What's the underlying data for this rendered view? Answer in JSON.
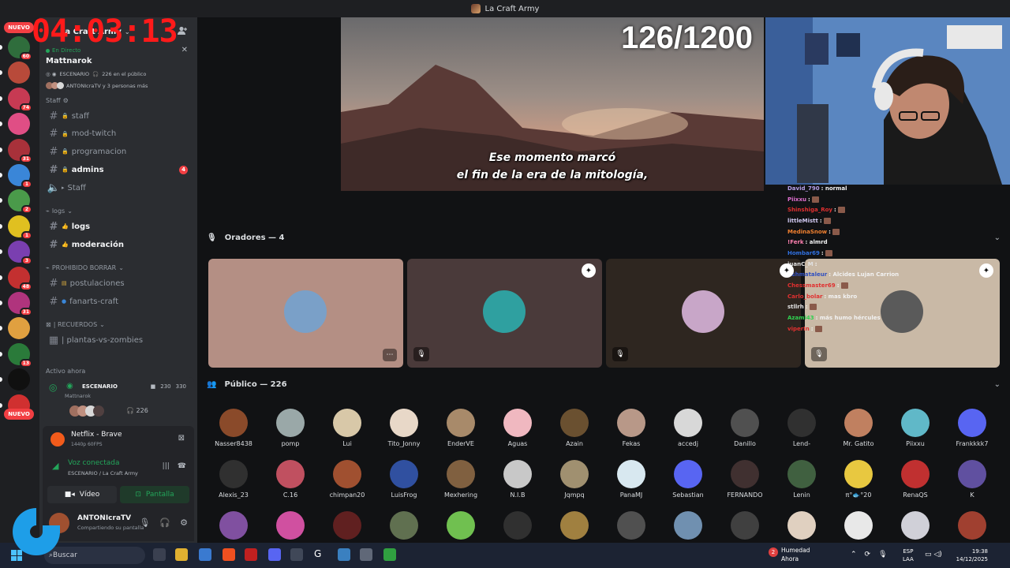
{
  "window": {
    "title": "La Craft Army"
  },
  "overlay": {
    "timer": "04:03:13",
    "progress": "126/1200"
  },
  "rail": {
    "new_label": "NUEVO",
    "servers": [
      {
        "color": "#2f6d3c",
        "badge": "60"
      },
      {
        "color": "#b84a3a",
        "badge": ""
      },
      {
        "color": "#c73a53",
        "badge": "74"
      },
      {
        "color": "#e04e85",
        "badge": ""
      },
      {
        "color": "#a8313a",
        "badge": "31"
      },
      {
        "color": "#3a86d8",
        "badge": "1"
      },
      {
        "color": "#4a9a4a",
        "badge": "2"
      },
      {
        "color": "#e0c020",
        "badge": "1"
      },
      {
        "color": "#7a3fb0",
        "badge": "3"
      },
      {
        "color": "#c33030",
        "badge": "48"
      },
      {
        "color": "#b0347d",
        "badge": "31"
      },
      {
        "color": "#e0a040",
        "badge": ""
      },
      {
        "color": "#2a7a3a",
        "badge": "13"
      },
      {
        "color": "#101010",
        "badge": ""
      },
      {
        "color": "#d03030",
        "badge": "68"
      }
    ]
  },
  "sidebar": {
    "server_name": "La Craft Army",
    "stage": {
      "live_label": "En Directo",
      "name": "Mattnarok",
      "scene_label": "ESCENARIO",
      "audience": "226 en el público",
      "people": "ANTONIcraTV y 3 personas más"
    },
    "channels_top": [
      {
        "label": "staff",
        "lock": true,
        "bold": false,
        "mention": ""
      },
      {
        "label": "mod-twitch",
        "lock": true,
        "bold": false,
        "mention": ""
      },
      {
        "label": "programacion",
        "lock": true,
        "bold": false,
        "mention": ""
      },
      {
        "label": "admins",
        "lock": true,
        "bold": true,
        "mention": "4"
      }
    ],
    "staff_voice": "Staff",
    "staff_category": "Staff",
    "cat_logs": "logs",
    "channels_logs": [
      {
        "label": "logs",
        "bold": true
      },
      {
        "label": "moderación",
        "bold": true
      }
    ],
    "cat_prohibido": "PROHIBIDO BORRAR",
    "channels_prohibido": [
      {
        "label": "postulaciones"
      },
      {
        "label": "fanarts-craft"
      }
    ],
    "cat_recuerdos": "| RECUERDOS",
    "channel_plantas": "|  plantas-vs-zombies",
    "active_now": "Activo ahora",
    "active_card": {
      "title": "ESCENARIO",
      "sub": "Mattnarok",
      "video_count": "230",
      "count2": "330",
      "people_count": "226"
    }
  },
  "bottom_panel": {
    "activity_app": "Netflix - Brave",
    "activity_quality": "1440p 60FPS",
    "voice_status": "Voz conectada",
    "voice_sub": "ESCENARIO / La Craft Army",
    "video_btn": "Vídeo",
    "share_btn": "Pantalla",
    "username": "ANTONIcraTV",
    "user_status": "Compartiendo su pantalla"
  },
  "main": {
    "subtitle_line1": "Ese momento marcó",
    "subtitle_line2": "el fin de la era de la mitología,",
    "speakers_title": "Oradores — 4",
    "audience_title": "Público — 226",
    "speaker_tiles": [
      {
        "bg": "#b48f84",
        "av": "#7aa0c8"
      },
      {
        "bg": "#4a3a3a",
        "av": "#2fa0a0"
      },
      {
        "bg": "#2e2620",
        "av": "#c8a6c8"
      },
      {
        "bg": "#c9b9a6",
        "av": "#5a5a5a"
      }
    ],
    "audience": [
      {
        "name": "Nasser8438",
        "color": "#8a4a2a"
      },
      {
        "name": "pomp",
        "color": "#9aa8a8"
      },
      {
        "name": "Lui",
        "color": "#d8c8a8"
      },
      {
        "name": "Tito_Jonny",
        "color": "#e8d8c8"
      },
      {
        "name": "EnderVE",
        "color": "#a88a6a"
      },
      {
        "name": "Aguas",
        "color": "#f0b8c0"
      },
      {
        "name": "Azain",
        "color": "#6a5030"
      },
      {
        "name": "Fekas",
        "color": "#b89888"
      },
      {
        "name": "accedj",
        "color": "#d8d8d8"
      },
      {
        "name": "Danillo",
        "color": "#505050"
      },
      {
        "name": "Lend-",
        "color": "#303030"
      },
      {
        "name": "Mr. Gatito",
        "color": "#c08060"
      },
      {
        "name": "Piixxu",
        "color": "#60b8c8"
      },
      {
        "name": "Frankkkk7",
        "color": "#5865f2"
      },
      {
        "name": "Alexis_23",
        "color": "#303030"
      },
      {
        "name": "C.16",
        "color": "#c05060"
      },
      {
        "name": "chimpan20",
        "color": "#a05030"
      },
      {
        "name": "LuisFrog",
        "color": "#3050a0"
      },
      {
        "name": "Mexhering",
        "color": "#806040"
      },
      {
        "name": "N.I.B",
        "color": "#c8c8c8"
      },
      {
        "name": "Jqmpq",
        "color": "#a09070"
      },
      {
        "name": "PanaMJ",
        "color": "#d8e8f0"
      },
      {
        "name": "Sebastian",
        "color": "#5865f2"
      },
      {
        "name": "FERNANDO",
        "color": "#403030"
      },
      {
        "name": "Lenin",
        "color": "#406040"
      },
      {
        "name": "π°🐟°20",
        "color": "#e8c840"
      },
      {
        "name": "RenaQS",
        "color": "#c03030"
      },
      {
        "name": "K",
        "color": "#6050a0"
      },
      {
        "name": "",
        "color": "#8050a0"
      },
      {
        "name": "",
        "color": "#d050a0"
      },
      {
        "name": "",
        "color": "#602020"
      },
      {
        "name": "",
        "color": "#607050"
      },
      {
        "name": "",
        "color": "#70c050"
      },
      {
        "name": "",
        "color": "#303030"
      },
      {
        "name": "",
        "color": "#a08040"
      },
      {
        "name": "",
        "color": "#505050"
      },
      {
        "name": "",
        "color": "#7090b0"
      },
      {
        "name": "",
        "color": "#404040"
      },
      {
        "name": "",
        "color": "#e0d0c0"
      },
      {
        "name": "",
        "color": "#e8e8e8"
      },
      {
        "name": "",
        "color": "#d0d0d8"
      },
      {
        "name": "",
        "color": "#a04030"
      }
    ]
  },
  "chat": [
    {
      "user": "David_790",
      "color": "#b8a0e8",
      "msg": ": normal",
      "emote": false
    },
    {
      "user": "Piixxu",
      "color": "#e070d0",
      "msg": ":",
      "emote": true
    },
    {
      "user": "Shinshiga_Roy",
      "color": "#e03030",
      "msg": ":",
      "emote": true
    },
    {
      "user": "littleMistt",
      "color": "#d0c8f0",
      "msg": ":",
      "emote": true
    },
    {
      "user": "MedinaSnow",
      "color": "#f08030",
      "msg": ":",
      "emote": true
    },
    {
      "user": "!Ferk",
      "color": "#ff80b0",
      "msg": ": almrd",
      "emote": false
    },
    {
      "user": "Hombar69",
      "color": "#3070e0",
      "msg": ":",
      "emote": true
    },
    {
      "user": "juanC_M",
      "color": "#e0e0e0",
      "msg": ":",
      "emote": false
    },
    {
      "user": "Ashmataleur",
      "color": "#3050c0",
      "msg": ": Alcides Lujan Carrion",
      "emote": false
    },
    {
      "user": "Chessmaster69",
      "color": "#e03030",
      "msg": ":",
      "emote": true
    },
    {
      "user": "Carlo_bolar",
      "color": "#e03030",
      "msg": ": mas kbro",
      "emote": false
    },
    {
      "user": "stllrh",
      "color": "#e0e0e0",
      "msg": ":",
      "emote": true
    },
    {
      "user": "Azami43",
      "color": "#30d050",
      "msg": ": más humo hércules",
      "emote": false
    },
    {
      "user": "viperIn",
      "color": "#e03030",
      "msg": ":",
      "emote": true
    }
  ],
  "taskbar": {
    "search": "Buscar",
    "weather_title": "Humedad",
    "weather_sub": "Ahora",
    "weather_badge": "2",
    "lang_top": "ESP",
    "lang_bottom": "LAA",
    "time": "19:38",
    "date": "14/12/2025"
  }
}
